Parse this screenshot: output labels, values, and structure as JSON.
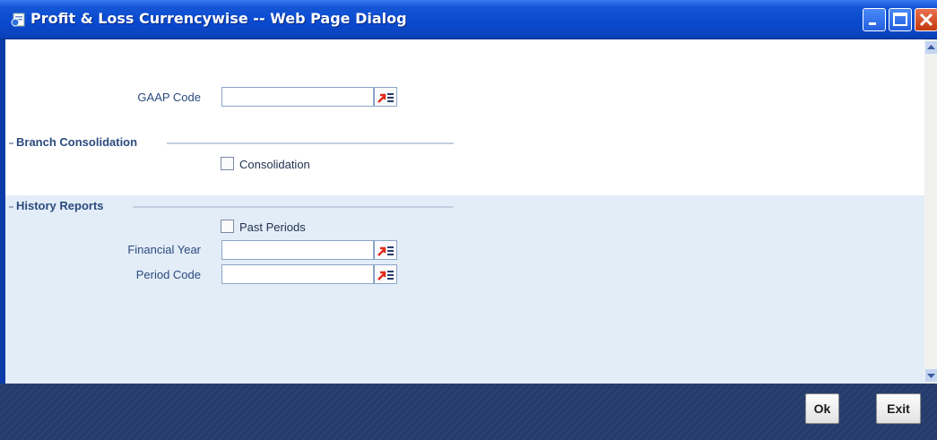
{
  "window": {
    "title": "Profit & Loss Currencywise -- Web Page Dialog"
  },
  "form": {
    "gaap_code": {
      "label": "GAAP Code",
      "value": ""
    },
    "branch_consolidation": {
      "title": "Branch Consolidation",
      "consolidation": {
        "label": "Consolidation",
        "checked": false
      }
    },
    "history_reports": {
      "title": "History Reports",
      "past_periods": {
        "label": "Past Periods",
        "checked": false
      },
      "financial_year": {
        "label": "Financial Year",
        "value": ""
      },
      "period_code": {
        "label": "Period Code",
        "value": ""
      }
    }
  },
  "footer": {
    "ok_label": "Ok",
    "exit_label": "Exit"
  },
  "colors": {
    "titlebar": "#0a4ad0",
    "footer": "#243b6c",
    "history_section_bg": "#e3edf7",
    "lov_arrow": "#e02a1a"
  },
  "icons": {
    "title": "ie-page-icon",
    "lov": "list-of-values-icon"
  }
}
